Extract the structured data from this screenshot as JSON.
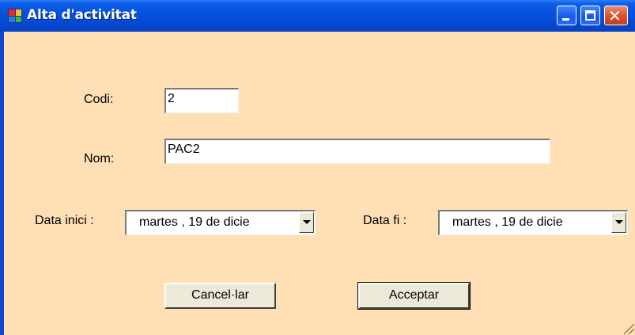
{
  "window": {
    "title": "Alta d'activitat",
    "icon": "form-app-icon",
    "controls": [
      "minimize-icon",
      "maximize-icon",
      "close-icon"
    ],
    "colors": {
      "titlebar": "#0651dd",
      "client_bg": "#ffdfb4",
      "close_button": "#d8512c"
    }
  },
  "form": {
    "codi": {
      "label": "Codi:",
      "value": "2"
    },
    "nom": {
      "label": "Nom:",
      "value": "PAC2"
    },
    "data_inici": {
      "label": "Data inici :",
      "value": "martes   , 19 de  dicie"
    },
    "data_fi": {
      "label": "Data fi :",
      "value": "martes   , 19 de  dicie"
    }
  },
  "buttons": {
    "cancel": "Cancel·lar",
    "accept": "Acceptar"
  }
}
